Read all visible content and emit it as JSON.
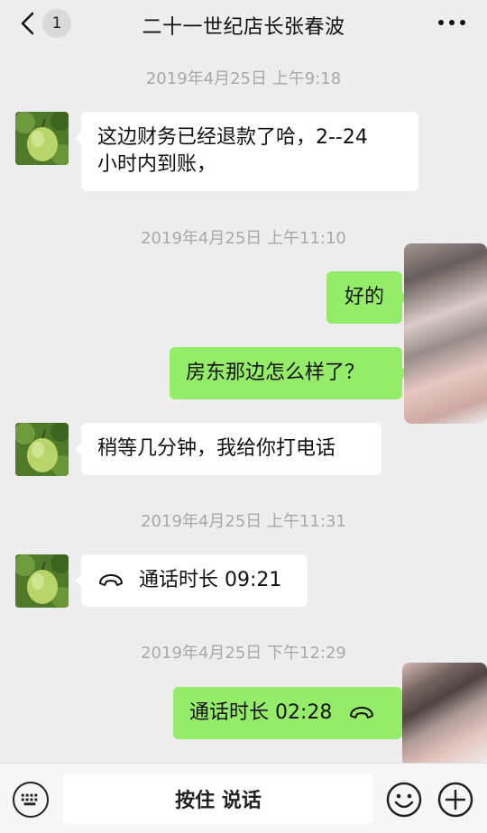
{
  "header": {
    "unread_count": "1",
    "title": "二十一世纪店长张春波"
  },
  "messages": [
    {
      "type": "time",
      "text": "2019年4月25日 上午9:18"
    },
    {
      "type": "in",
      "text": "这边财务已经退款了哈，2--24\n小时内到账，"
    },
    {
      "type": "time",
      "text": "2019年4月25日 上午11:10"
    },
    {
      "type": "out",
      "text": "好的"
    },
    {
      "type": "out",
      "text": "房东那边怎么样了？"
    },
    {
      "type": "in",
      "text": "稍等几分钟，我给你打电话"
    },
    {
      "type": "time",
      "text": "2019年4月25日 上午11:31"
    },
    {
      "type": "in_call",
      "text": "通话时长 09:21"
    },
    {
      "type": "time",
      "text": "2019年4月25日 下午12:29"
    },
    {
      "type": "out_call",
      "text": "通话时长 02:28"
    }
  ],
  "input_bar": {
    "hold_to_talk_label": "按住 说话"
  },
  "icons": {
    "back": "chevron-left-icon",
    "more": "more-dots-icon",
    "avatar": "pomelo-avatar",
    "call": "phone-handset-icon",
    "keyboard": "keyboard-icon",
    "emoji": "emoji-icon",
    "plus": "plus-icon"
  },
  "colors": {
    "background": "#ededed",
    "incoming_bubble": "#ffffff",
    "outgoing_bubble": "#95ec69",
    "timestamp": "#a8a8a8"
  }
}
